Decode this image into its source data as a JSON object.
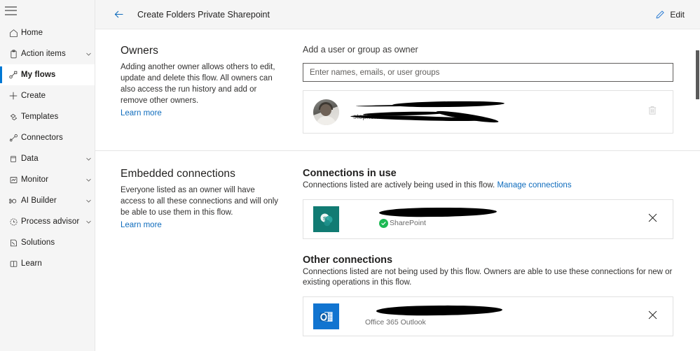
{
  "sidebar": {
    "menu_icon": "hamburger-icon",
    "items": [
      {
        "label": "Home",
        "icon": "home-icon",
        "expandable": false,
        "selected": false
      },
      {
        "label": "Action items",
        "icon": "clipboard-icon",
        "expandable": true,
        "selected": false
      },
      {
        "label": "My flows",
        "icon": "flow-icon",
        "expandable": false,
        "selected": true
      },
      {
        "label": "Create",
        "icon": "plus-icon",
        "expandable": false,
        "selected": false
      },
      {
        "label": "Templates",
        "icon": "templates-icon",
        "expandable": false,
        "selected": false
      },
      {
        "label": "Connectors",
        "icon": "connectors-icon",
        "expandable": false,
        "selected": false
      },
      {
        "label": "Data",
        "icon": "database-icon",
        "expandable": true,
        "selected": false
      },
      {
        "label": "Monitor",
        "icon": "monitor-chart-icon",
        "expandable": true,
        "selected": false
      },
      {
        "label": "AI Builder",
        "icon": "ai-builder-icon",
        "expandable": true,
        "selected": false
      },
      {
        "label": "Process advisor",
        "icon": "process-advisor-icon",
        "expandable": true,
        "selected": false
      },
      {
        "label": "Solutions",
        "icon": "solutions-icon",
        "expandable": false,
        "selected": false
      },
      {
        "label": "Learn",
        "icon": "learn-book-icon",
        "expandable": false,
        "selected": false
      }
    ]
  },
  "commandbar": {
    "back_icon": "back-arrow-icon",
    "title": "Create Folders Private Sharepoint",
    "edit_label": "Edit",
    "edit_icon": "pencil-icon"
  },
  "owners_section": {
    "heading": "Owners",
    "description": "Adding another owner allows others to edit, update and delete this flow. All owners can also access the run history and add or remove other owners.",
    "learn_more": "Learn more",
    "add_owner_label": "Add a user or group as owner",
    "input_placeholder": "Enter names, emails, or user groups",
    "input_value": "",
    "owner_row": {
      "avatar": "user-avatar",
      "name_redacted": true,
      "email_redacted": true,
      "delete_icon": "trash-icon"
    }
  },
  "embedded_section": {
    "heading": "Embedded connections",
    "description": "Everyone listed as an owner will have access to all these connections and will only be able to use them in this flow.",
    "learn_more": "Learn more",
    "connections_in_use": {
      "heading": "Connections in use",
      "description": "Connections listed are actively being used in this flow.",
      "manage_link": "Manage connections",
      "items": [
        {
          "icon": "sharepoint-icon",
          "icon_color": "#117b73",
          "account_redacted": true,
          "service_name": "SharePoint",
          "status_icon": "green-check-icon",
          "status_color": "#1db954",
          "remove_icon": "close-icon"
        }
      ]
    },
    "other_connections": {
      "heading": "Other connections",
      "description": "Connections listed are not being used by this flow. Owners are able to use these connections for new or existing operations in this flow.",
      "items": [
        {
          "icon": "office365-outlook-icon",
          "icon_color": "#1174d0",
          "account_redacted": true,
          "service_name": "Office 365 Outlook",
          "remove_icon": "close-icon"
        }
      ]
    }
  },
  "colors": {
    "accent": "#0078d4",
    "link": "#0f6cbd",
    "sidebar_bg": "#f5f5f5",
    "commandbar_bg": "#f5f5f5",
    "status_green": "#1db954"
  }
}
